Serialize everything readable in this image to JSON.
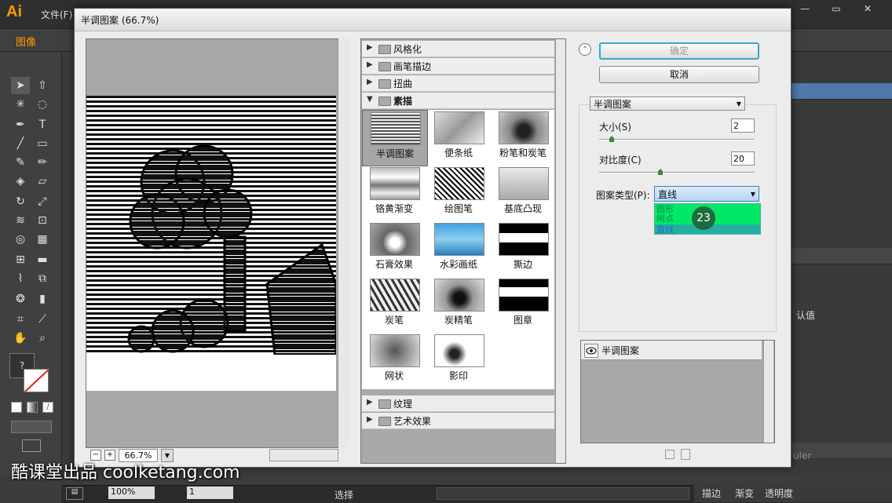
{
  "app": {
    "logo": "Ai",
    "menu_file": "文件(F)",
    "control_label": "图像",
    "window_buttons": [
      "—",
      "▭",
      "✕"
    ]
  },
  "dialog": {
    "title": "半调图案 (66.7%)",
    "zoom": "66.7%",
    "zoom_minus": "−",
    "zoom_plus": "+",
    "ok_label": "确定",
    "cancel_label": "取消",
    "filter_select": "半调图案",
    "params": {
      "size_label": "大小(S)",
      "size_value": "2",
      "contrast_label": "对比度(C)",
      "contrast_value": "20",
      "pattern_type_label": "图案类型(P):",
      "pattern_type_value": "直线",
      "pattern_options": [
        "圆形",
        "网点",
        "直线"
      ]
    },
    "step_badge": "23",
    "layer_name": "半调图案"
  },
  "categories_top": [
    "风格化",
    "画笔描边",
    "扭曲",
    "素描"
  ],
  "categories_bottom": [
    "纹理",
    "艺术效果"
  ],
  "thumbnails": [
    [
      "半调图案",
      "便条纸",
      "粉笔和炭笔"
    ],
    [
      "铬黄渐变",
      "绘图笔",
      "基底凸现"
    ],
    [
      "石膏效果",
      "水彩画纸",
      "撕边"
    ],
    [
      "炭笔",
      "炭精笔",
      "图章"
    ],
    [
      "网状",
      "影印"
    ]
  ],
  "statusbar": {
    "zoom": "100%",
    "page": "1",
    "tool": "选择"
  },
  "right_panel": {
    "default_label": "认值",
    "ruler_label": "uler"
  },
  "bottom_tabs": [
    "描边",
    "渐变",
    "透明度"
  ],
  "watermark": "酷课堂出品 coolketang.com",
  "colors": {
    "ai_orange": "#ff9a00",
    "ok_border": "#39a7c9",
    "highlight_green": "#00e865",
    "badge_green": "#1f6b3c"
  }
}
